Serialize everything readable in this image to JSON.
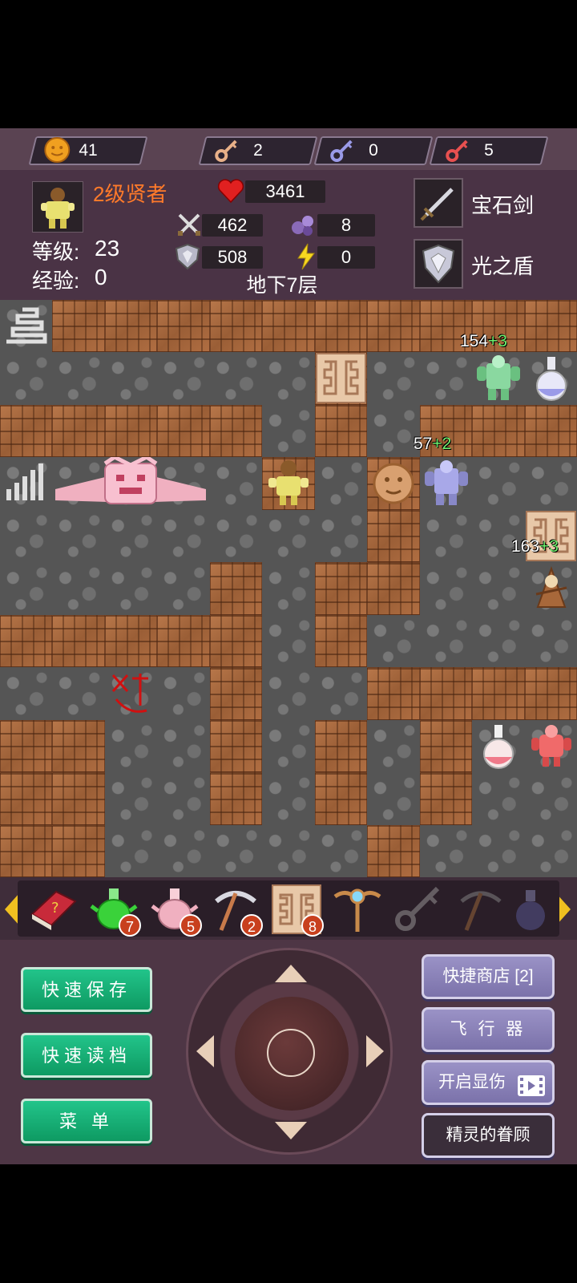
{
  "resources": {
    "coins": "41",
    "yellow_keys": "2",
    "blue_keys": "0",
    "red_keys": "5"
  },
  "hero": {
    "title": "2级贤者",
    "level_label": "等级:",
    "level": "23",
    "exp_label": "经验:",
    "exp": "0",
    "hp": "3461",
    "attack": "462",
    "defense": "508",
    "magic_defense": "8",
    "energy": "0",
    "floor": "地下7层"
  },
  "equipment": {
    "weapon": "宝石剑",
    "shield": "光之盾"
  },
  "map_labels": {
    "green_knight": {
      "dmg": "154",
      "plus": "+3"
    },
    "blue_knight": {
      "dmg": "57",
      "plus": "+2"
    },
    "brown_mage": {
      "dmg": "163",
      "plus": "+3"
    }
  },
  "items": [
    {
      "name": "monster-manual",
      "count": ""
    },
    {
      "name": "green-potion-flask",
      "count": "7"
    },
    {
      "name": "pink-potion-flask",
      "count": "5"
    },
    {
      "name": "pickaxe",
      "count": "2"
    },
    {
      "name": "door-scroll",
      "count": "8"
    },
    {
      "name": "winged-staff",
      "count": ""
    },
    {
      "name": "gray-key",
      "count": ""
    },
    {
      "name": "dark-pickaxe",
      "count": ""
    },
    {
      "name": "dark-flask",
      "count": ""
    }
  ],
  "buttons": {
    "quick_save": "快速保存",
    "quick_load": "快速读档",
    "menu": "菜 单",
    "quick_shop": "快捷商店 [2]",
    "flyer": "飞 行 器",
    "show_damage": "开启显伤",
    "fairy_blessing": "精灵的眷顾"
  },
  "colors": {
    "hero_title": "#ff7a2a",
    "green_button": "#17b27a",
    "purple_button": "#8a82b8",
    "badge": "#c8401e",
    "plus_text": "#6ef06e"
  }
}
